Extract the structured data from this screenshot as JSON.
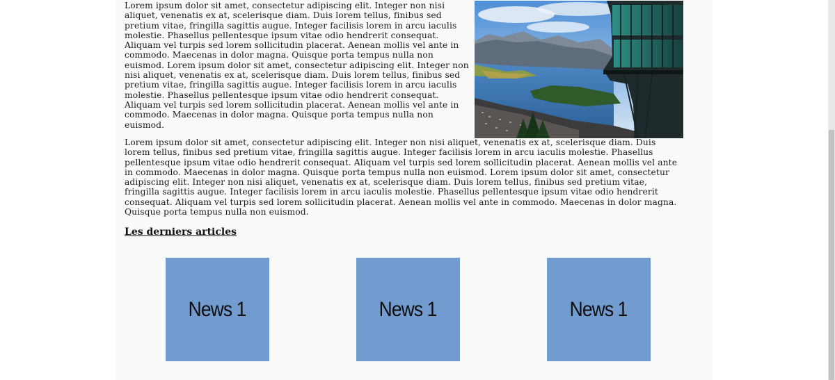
{
  "article": {
    "paragraph1": "Lorem ipsum dolor sit amet, consectetur adipiscing elit. Integer non nisi aliquet, venenatis ex at, scelerisque diam. Duis lorem tellus, finibus sed pretium vitae, fringilla sagittis augue. Integer facilisis lorem in arcu iaculis molestie. Phasellus pellentesque ipsum vitae odio hendrerit consequat. Aliquam vel turpis sed lorem sollicitudin placerat. Aenean mollis vel ante in commodo. Maecenas in dolor magna. Quisque porta tempus nulla non euismod. Lorem ipsum dolor sit amet, consectetur adipiscing elit. Integer non nisi aliquet, venenatis ex at, scelerisque diam. Duis lorem tellus, finibus sed pretium vitae, fringilla sagittis augue. Integer facilisis lorem in arcu iaculis molestie. Phasellus pellentesque ipsum vitae odio hendrerit consequat. Aliquam vel turpis sed lorem sollicitudin placerat. Aenean mollis vel ante in commodo. Maecenas in dolor magna. Quisque porta tempus nulla non euismod.",
    "paragraph2": "Lorem ipsum dolor sit amet, consectetur adipiscing elit. Integer non nisi aliquet, venenatis ex at, scelerisque diam. Duis lorem tellus, finibus sed pretium vitae, fringilla sagittis augue. Integer facilisis lorem in arcu iaculis molestie. Phasellus pellentesque ipsum vitae odio hendrerit consequat. Aliquam vel turpis sed lorem sollicitudin placerat. Aenean mollis vel ante in commodo. Maecenas in dolor magna. Quisque porta tempus nulla non euismod. Lorem ipsum dolor sit amet, consectetur adipiscing elit. Integer non nisi aliquet, venenatis ex at, scelerisque diam. Duis lorem tellus, finibus sed pretium vitae, fringilla sagittis augue. Integer facilisis lorem in arcu iaculis molestie. Phasellus pellentesque ipsum vitae odio hendrerit consequat. Aliquam vel turpis sed lorem sollicitudin placerat. Aenean mollis vel ante in commodo. Maecenas in dolor magna. Quisque porta tempus nulla non euismod.",
    "image": "lake-mountain-landscape-photo"
  },
  "latest_articles": {
    "title": "Les derniers articles",
    "items": [
      {
        "label": "News 1"
      },
      {
        "label": "News 1"
      },
      {
        "label": "News 1"
      }
    ]
  },
  "colors": {
    "card_background": "#729ccf",
    "page_background": "#fafafa",
    "scrollbar_thumb": "#c2c2c2"
  }
}
